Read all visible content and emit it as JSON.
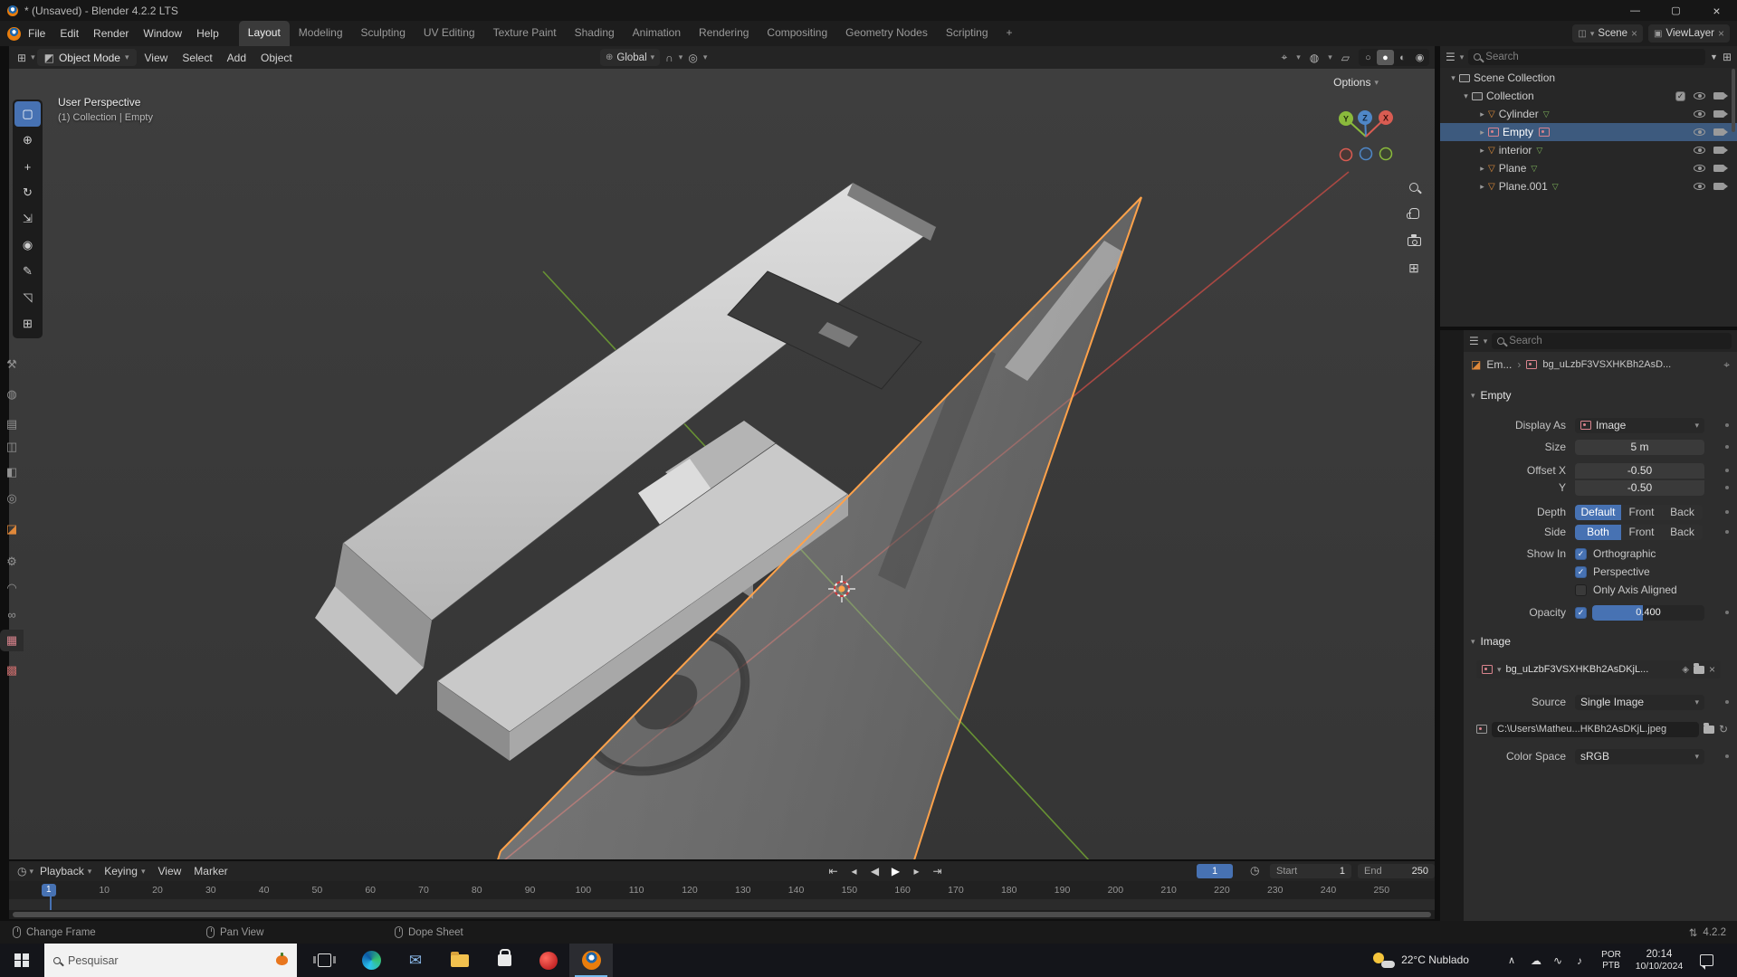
{
  "window": {
    "title": "* (Unsaved) - Blender 4.2.2 LTS"
  },
  "topbar": {
    "menus": [
      "File",
      "Edit",
      "Render",
      "Window",
      "Help"
    ],
    "workspaces": [
      "Layout",
      "Modeling",
      "Sculpting",
      "UV Editing",
      "Texture Paint",
      "Shading",
      "Animation",
      "Rendering",
      "Compositing",
      "Geometry Nodes",
      "Scripting"
    ],
    "add_workspace": "+",
    "scene_name": "Scene",
    "view_layer_name": "ViewLayer"
  },
  "viewport_header": {
    "mode": "Object Mode",
    "menu_view": "View",
    "menu_select": "Select",
    "menu_add": "Add",
    "menu_object": "Object",
    "orientation": "Global",
    "options": "Options"
  },
  "viewport": {
    "label_perspective": "User Perspective",
    "label_context": "(1) Collection | Empty",
    "axis_y": "Y",
    "axis_z": "Z",
    "axis_x": "X"
  },
  "outliner": {
    "search_placeholder": "Search",
    "rows": [
      {
        "label": "Scene Collection"
      },
      {
        "label": "Collection"
      },
      {
        "label": "Cylinder"
      },
      {
        "label": "Empty"
      },
      {
        "label": "interior"
      },
      {
        "label": "Plane"
      },
      {
        "label": "Plane.001"
      }
    ]
  },
  "properties": {
    "search_placeholder": "Search",
    "breadcrumb_object": "Em...",
    "breadcrumb_data": "bg_uLzbF3VSXHKBh2AsD...",
    "panel_empty": {
      "title": "Empty",
      "display_as_label": "Display As",
      "display_as_value": "Image",
      "size_label": "Size",
      "size_value": "5 m",
      "offset_x_label": "Offset X",
      "offset_x_value": "-0.50",
      "offset_y_label": "Y",
      "offset_y_value": "-0.50",
      "depth_label": "Depth",
      "depth_default": "Default",
      "depth_front": "Front",
      "depth_back": "Back",
      "side_label": "Side",
      "side_both": "Both",
      "side_front": "Front",
      "side_back": "Back",
      "show_in_label": "Show In",
      "orthographic_label": "Orthographic",
      "perspective_label": "Perspective",
      "only_axis_label": "Only Axis Aligned",
      "opacity_label": "Opacity",
      "opacity_value": "0.400",
      "opacity_fill_percent": 45
    },
    "panel_image": {
      "title": "Image",
      "datablock_name": "bg_uLzbF3VSXHKBh2AsDKjL...",
      "source_label": "Source",
      "source_value": "Single Image",
      "filepath": "C:\\Users\\Matheu...HKBh2AsDKjL.jpeg",
      "colorspace_label": "Color Space",
      "colorspace_value": "sRGB"
    }
  },
  "timeline": {
    "menu_playback": "Playback",
    "menu_keying": "Keying",
    "menu_view": "View",
    "menu_marker": "Marker",
    "current_frame": "1",
    "start_label": "Start",
    "start_value": "1",
    "end_label": "End",
    "end_value": "250",
    "ruler": [
      "1",
      "10",
      "20",
      "30",
      "40",
      "50",
      "60",
      "70",
      "80",
      "90",
      "100",
      "110",
      "120",
      "130",
      "140",
      "150",
      "160",
      "170",
      "180",
      "190",
      "200",
      "210",
      "220",
      "230",
      "240",
      "250"
    ]
  },
  "statusbar": {
    "hint_1": "Change Frame",
    "hint_2": "Pan View",
    "hint_3": "Dope Sheet",
    "version": "4.2.2"
  },
  "taskbar": {
    "search_placeholder": "Pesquisar",
    "weather_text": "22°C Nublado",
    "lang_top": "POR",
    "lang_bottom": "PTB",
    "time": "20:14",
    "date": "10/10/2024"
  },
  "colors": {
    "accent_blue": "#4772b3",
    "selection_orange": "#ffa24a",
    "blender_orange": "#e87d0d",
    "axis_x": "#d95c52",
    "axis_y": "#8aba3c",
    "axis_z": "#4f87c7"
  },
  "icons": {
    "dropdown": "▾",
    "expand_open": "▾",
    "expand_closed": "▸",
    "minimize": "—",
    "maximize": "▢",
    "close": "×",
    "check": "✓",
    "mesh_object": "▽",
    "mesh_data": "▽",
    "magnet": "∩",
    "prop_edit": "◎",
    "orientation_globe": "⊕",
    "editor_grid": "⊞",
    "ortho_grid": "⊞",
    "mode_icon": "◩",
    "chevron_up": "∧",
    "refresh": "↻",
    "pin": "⌖",
    "shield": "◈",
    "breadcrumb_sep": "›",
    "transport_jump_start": "⇤",
    "transport_prev_key": "◂",
    "transport_play_back": "◀",
    "transport_play": "▶",
    "transport_next_key": "▸",
    "transport_jump_end": "⇥",
    "gizmo_toggle": "⌖",
    "overlays_toggle": "◍",
    "xray_toggle": "▱",
    "shade_wire": "○",
    "shade_solid": "●",
    "shade_material": "◐",
    "shade_render": "◉",
    "tool_select": "▢",
    "tool_cursor": "⊕",
    "tool_move": "+",
    "tool_rotate": "↻",
    "tool_scale": "⇲",
    "tool_transform": "◉",
    "tool_annotate": "✎",
    "tool_measure": "◹",
    "tool_add": "⊞",
    "tab_tool": "⚒",
    "tab_render": "◍",
    "tab_output": "▤",
    "tab_viewlayer": "◫",
    "tab_scene": "◧",
    "tab_world": "◎",
    "tab_object": "◪",
    "tab_modifiers": "⚙",
    "tab_physics": "◠",
    "tab_constraints": "∞",
    "tab_data": "▦",
    "tab_texture": "▩",
    "scene_widget": "◫",
    "viewlayer_widget": "▣",
    "tray_1": "☁",
    "tray_2": "∿",
    "tray_3": "♪",
    "version_net": "⇅",
    "timeline_editor": "◷",
    "outliner_editor": "☰",
    "filter": "▼",
    "new_collection": "⊞"
  }
}
